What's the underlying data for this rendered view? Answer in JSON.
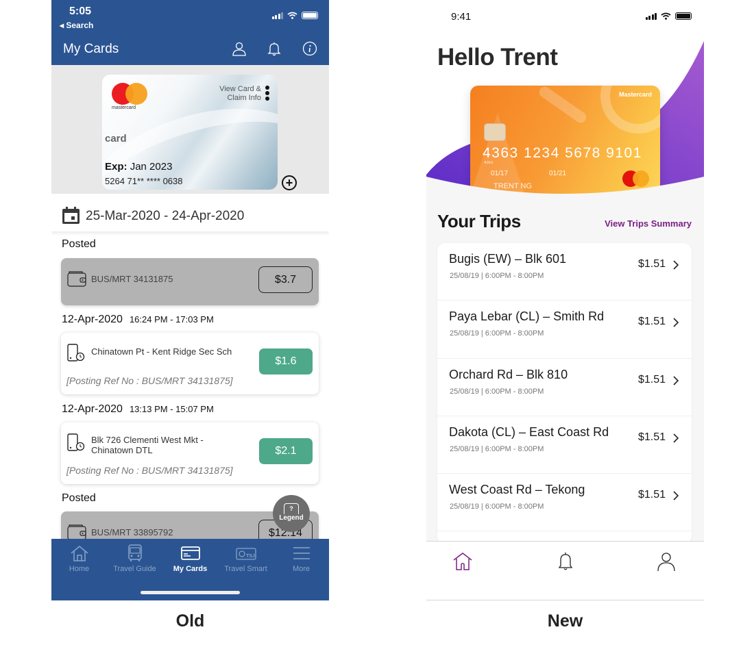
{
  "old": {
    "caption": "Old",
    "status_bar": {
      "time": "5:05",
      "back_label": "◂ Search"
    },
    "header": {
      "title": "My Cards",
      "icons": [
        "user-icon",
        "bell-icon",
        "info-icon"
      ]
    },
    "card": {
      "brand": "mastercard",
      "view_info": "View Card &",
      "view_info_line2": "Claim Info",
      "name": "card",
      "exp_label": "Exp:",
      "exp_value": "Jan 2023",
      "number": "5264 71** **** 0638",
      "add_label": "+"
    },
    "date_range": "25-Mar-2020 - 24-Apr-2020",
    "transactions": [
      {
        "section": "Posted",
        "ref": "BUS/MRT 34131875",
        "amount": "$3.7"
      },
      {
        "date": "12-Apr-2020",
        "time": "16:24 PM - 17:03 PM",
        "route": "Chinatown Pt - Kent Ridge Sec Sch",
        "posting_ref": "[Posting Ref No : BUS/MRT 34131875]",
        "amount": "$1.6"
      },
      {
        "date": "12-Apr-2020",
        "time": "13:13 PM - 15:07 PM",
        "route": "Blk 726 Clementi West Mkt - Chinatown DTL",
        "posting_ref": "[Posting Ref No : BUS/MRT 34131875]",
        "amount": "$2.1"
      },
      {
        "section": "Posted",
        "ref": "BUS/MRT 33895792",
        "amount": "$12.14"
      }
    ],
    "legend": {
      "icon_text": "?",
      "label": "Legend"
    },
    "tabs": [
      {
        "label": "Home",
        "icon": "home-icon",
        "active": false
      },
      {
        "label": "Travel Guide",
        "icon": "bus-icon",
        "active": false
      },
      {
        "label": "My Cards",
        "icon": "card-icon",
        "active": true
      },
      {
        "label": "Travel Smart",
        "icon": "travel-smart-card-icon",
        "active": false
      },
      {
        "label": "More",
        "icon": "menu-icon",
        "active": false
      }
    ],
    "colors": {
      "primary": "#2b5592",
      "fare_green": "#4ea88a",
      "posted_grey": "#b3b3b3"
    }
  },
  "new": {
    "caption": "New",
    "status_bar": {
      "time": "9:41"
    },
    "greeting": "Hello Trent",
    "card": {
      "brand": "Mastercard",
      "number": "4363  1234  5678  9101",
      "number_small": "4363",
      "valid_from": "01/17",
      "valid_thru": "01/21",
      "holder": "TRENT NG"
    },
    "trips": {
      "title": "Your Trips",
      "link": "View Trips Summary",
      "items": [
        {
          "route": "Bugis (EW) – Blk 601",
          "meta": "25/08/19 | 6:00PM - 8:00PM",
          "price": "$1.51"
        },
        {
          "route": "Paya Lebar (CL) – Smith Rd",
          "meta": "25/08/19 | 6:00PM - 8:00PM",
          "price": "$1.51"
        },
        {
          "route": "Orchard Rd – Blk 810",
          "meta": "25/08/19 | 6:00PM - 8:00PM",
          "price": "$1.51"
        },
        {
          "route": "Dakota (CL) – East Coast Rd",
          "meta": "25/08/19 | 6:00PM - 8:00PM",
          "price": "$1.51"
        },
        {
          "route": "West Coast Rd – Tekong",
          "meta": "25/08/19 | 6:00PM - 8:00PM",
          "price": "$1.51"
        }
      ]
    },
    "nav": [
      {
        "icon": "home-icon",
        "active": true
      },
      {
        "icon": "bell-icon",
        "active": false
      },
      {
        "icon": "user-icon",
        "active": false
      }
    ],
    "colors": {
      "accent": "#7b1f86",
      "blob_purple": "#8e4fcf",
      "card_orange": "#f57f20"
    }
  }
}
